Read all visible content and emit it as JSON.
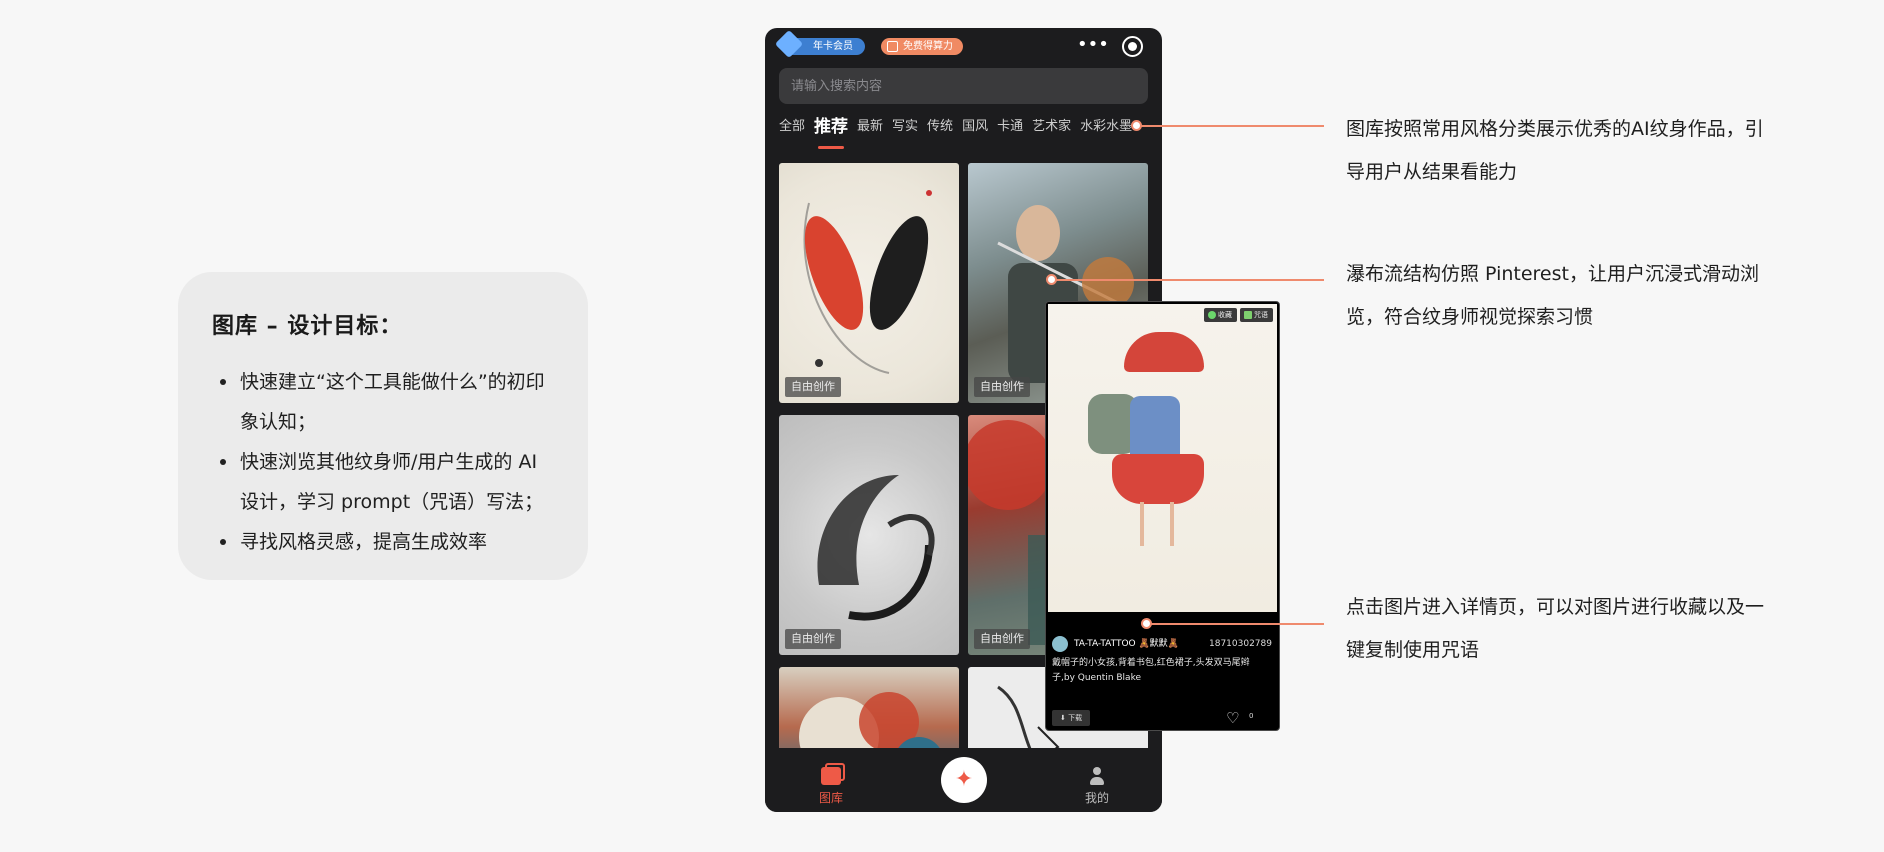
{
  "goals": {
    "title": "图库 – 设计目标：",
    "items": [
      "快速建立“这个工具能做什么”的初印象认知；",
      "快速浏览其他纹身师/用户生成的 AI 设计，学习 prompt（咒语）写法；",
      "寻找风格灵感，提高生成效率"
    ]
  },
  "phone": {
    "vip_badge": "年卡会员",
    "free_badge": "免费得算力",
    "search_placeholder": "请输入搜索内容",
    "tabs": [
      "全部",
      "推荐",
      "最新",
      "写实",
      "传统",
      "国风",
      "卡通",
      "艺术家",
      "水彩水墨"
    ],
    "active_tab": "推荐",
    "card_label": "自由创作",
    "tabbar": {
      "gallery": "图库",
      "me": "我的"
    }
  },
  "detail": {
    "fav_chip": "收藏",
    "copy_chip": "咒语",
    "username": "TA-TA-TATTOO 🧸默默🧸",
    "user_id": "18710302789",
    "prompt": "戴帽子的小女孩,背着书包,红色裙子,头发双马尾辫子,by Quentin Blake",
    "download": "⬇ 下载",
    "likes": "0"
  },
  "annotations": [
    "图库按照常用风格分类展示优秀的AI纹身作品，引导用户从结果看能力",
    "瀑布流结构仿照 Pinterest，让用户沉浸式滑动浏览，符合纹身师视觉探索习惯",
    "点击图片进入详情页，可以对图片进行收藏以及一键复制使用咒语"
  ],
  "colors": {
    "accent": "#ee5a47",
    "connector": "#ef8a6d"
  }
}
